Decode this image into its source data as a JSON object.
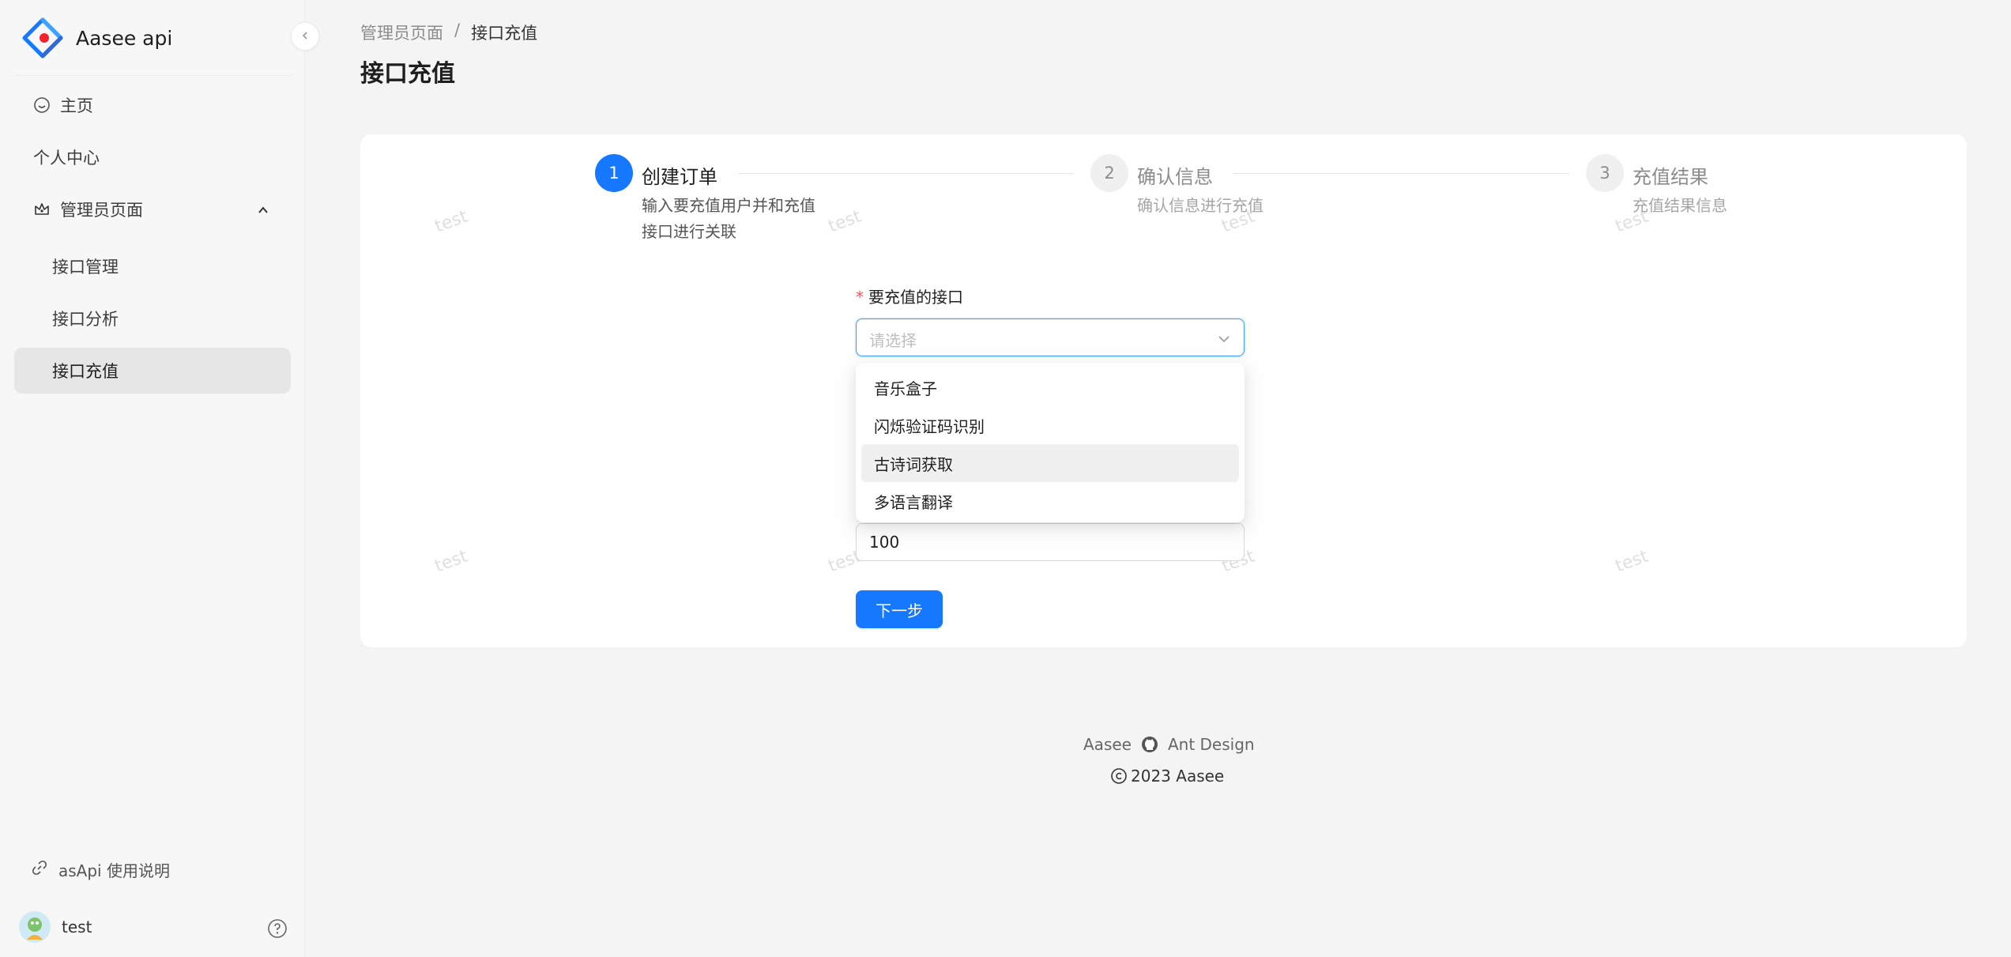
{
  "app": {
    "title": "Aasee api"
  },
  "sidebar": {
    "items": [
      {
        "label": "主页"
      },
      {
        "label": "个人中心"
      },
      {
        "label": "管理员页面"
      },
      {
        "label": "接口管理"
      },
      {
        "label": "接口分析"
      },
      {
        "label": "接口充值"
      }
    ],
    "help_link": "asApi 使用说明",
    "user_name": "test"
  },
  "breadcrumb": {
    "parent": "管理员页面",
    "separator": "/",
    "current": "接口充值"
  },
  "page_title": "接口充值",
  "steps": [
    {
      "number": "1",
      "title": "创建订单",
      "description": "输入要充值用户并和充值接口进行关联",
      "status": "active"
    },
    {
      "number": "2",
      "title": "确认信息",
      "description": "确认信息进行充值",
      "status": "wait"
    },
    {
      "number": "3",
      "title": "充值结果",
      "description": "充值结果信息",
      "status": "wait"
    }
  ],
  "form": {
    "required_mark": "*",
    "interface_label": "要充值的接口",
    "interface_placeholder": "请选择",
    "amount_value": "100",
    "next_button": "下一步"
  },
  "dropdown": {
    "options": [
      "音乐盒子",
      "闪烁验证码识别",
      "古诗词获取",
      "多语言翻译"
    ],
    "hovered_index": 2
  },
  "watermark": "test",
  "footer": {
    "left": "Aasee",
    "right": "Ant Design",
    "copyright": "2023 Aasee"
  },
  "colors": {
    "primary": "#1677ff",
    "required": "#ff4d4f",
    "active_menu_bg": "#e6e6e6"
  }
}
